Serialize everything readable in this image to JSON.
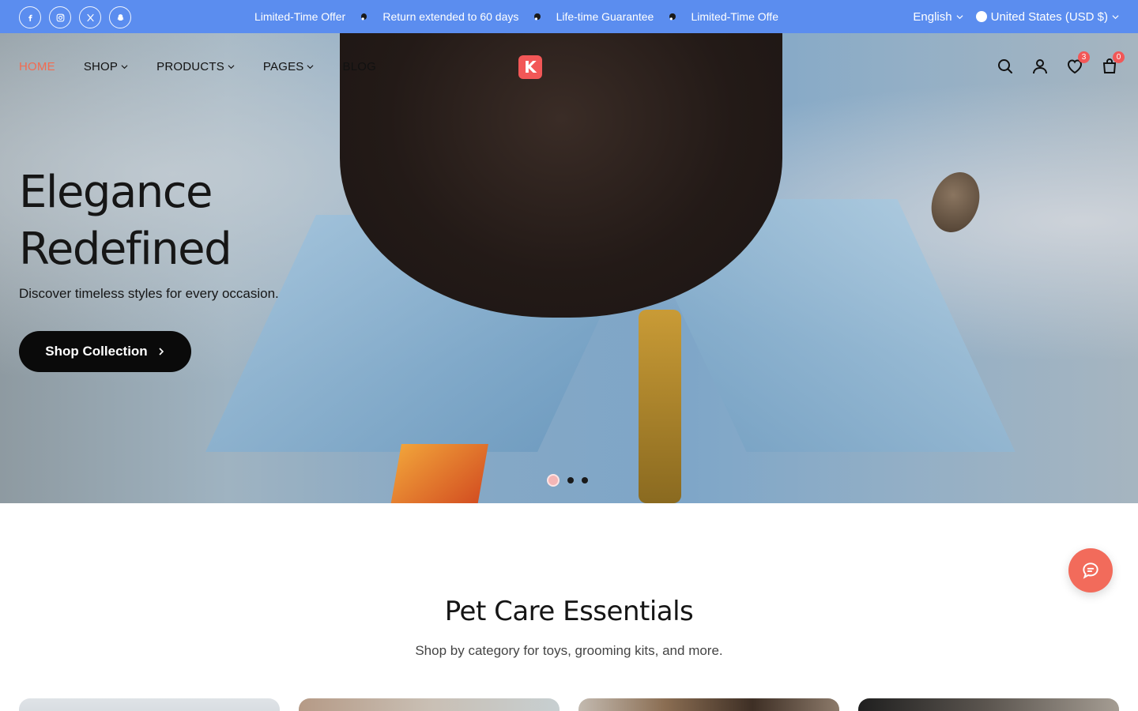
{
  "colors": {
    "topbar_bg": "#5b8def",
    "accent": "#f26b50",
    "logo_red": "#f25757",
    "cta_bg": "#0a0a0a",
    "chat_bg": "#f26b5b"
  },
  "topbar": {
    "socials": [
      "facebook-icon",
      "instagram-icon",
      "x-icon",
      "snapchat-icon"
    ],
    "announcements": [
      "Limited-Time Offer",
      "Return extended to 60 days",
      "Life-time Guarantee",
      "Limited-Time Offe"
    ],
    "language": "English",
    "currency": "United States (USD $)"
  },
  "nav": {
    "items": [
      {
        "label": "HOME",
        "active": true,
        "dropdown": false
      },
      {
        "label": "SHOP",
        "active": false,
        "dropdown": true
      },
      {
        "label": "PRODUCTS",
        "active": false,
        "dropdown": true
      },
      {
        "label": "PAGES",
        "active": false,
        "dropdown": true
      },
      {
        "label": "BLOG",
        "active": false,
        "dropdown": false
      }
    ],
    "logo_letter": "K",
    "wishlist_count": "3",
    "cart_count": "0"
  },
  "hero": {
    "title_line1": "Elegance",
    "title_line2": "Redefined",
    "subtitle": "Discover timeless styles for every occasion.",
    "cta_label": "Shop Collection",
    "slides": 3,
    "active_slide": 1
  },
  "section": {
    "title": "Pet Care Essentials",
    "subtitle": "Shop by category for toys, grooming kits, and more."
  }
}
